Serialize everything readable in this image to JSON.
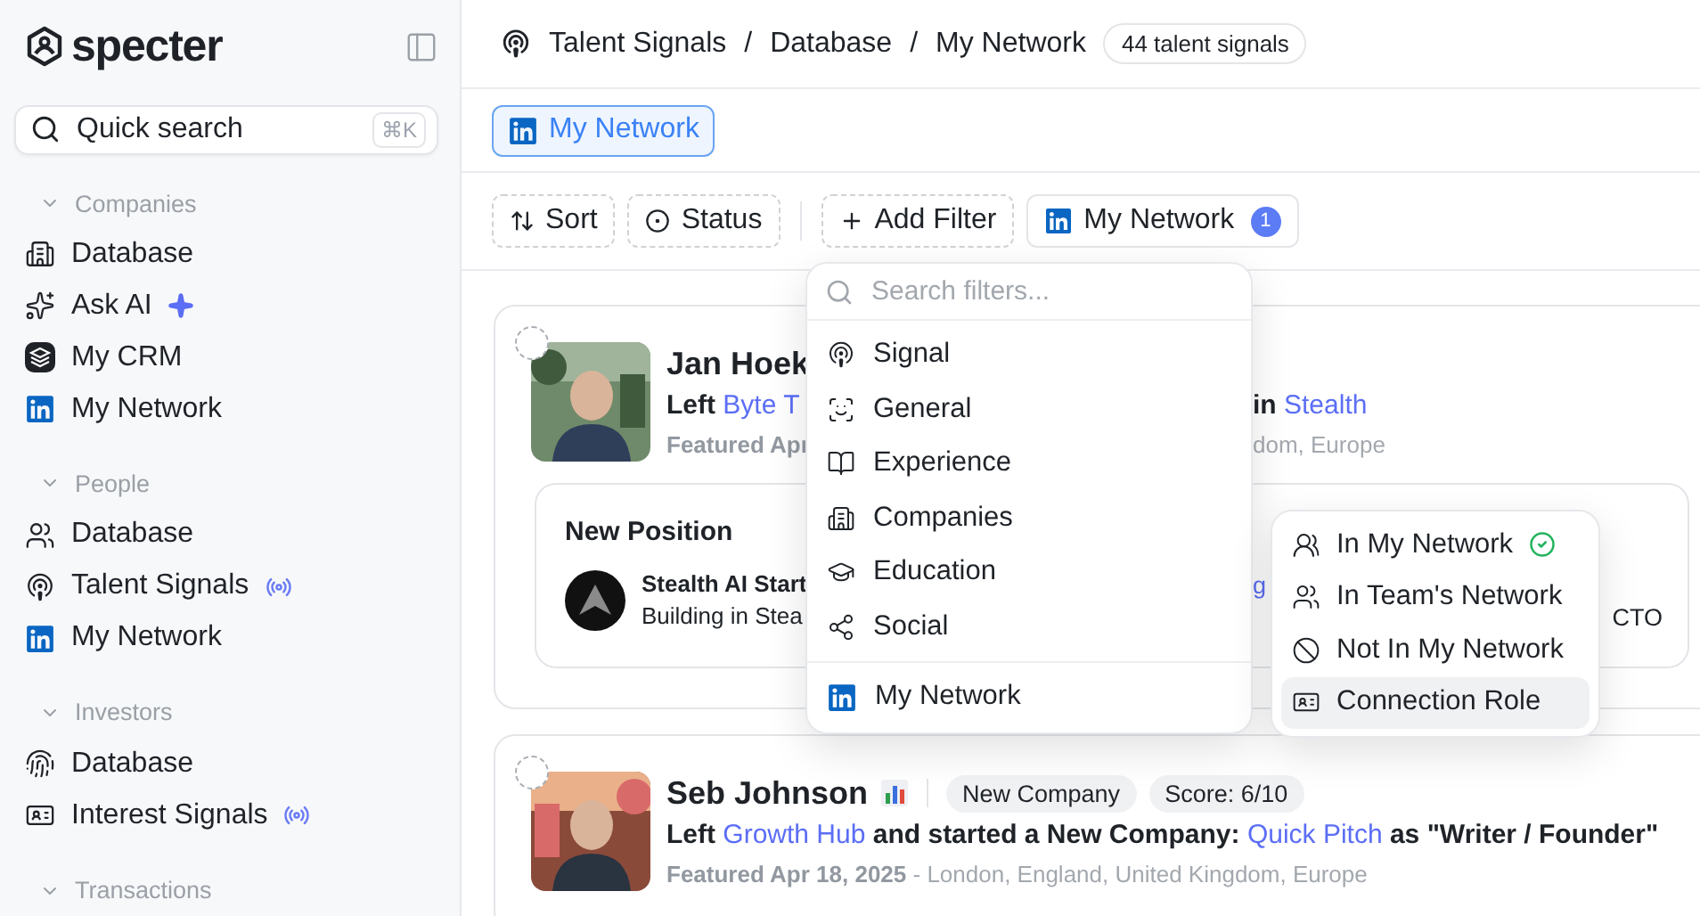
{
  "sidebar": {
    "brand": "specter",
    "quick_search": {
      "label": "Quick search",
      "shortcut": "⌘K"
    },
    "sections": [
      {
        "title": "Companies",
        "expanded": true,
        "items": [
          {
            "label": "Database",
            "kind": "plain"
          },
          {
            "label": "Ask AI",
            "kind": "ai"
          },
          {
            "label": "My CRM",
            "kind": "plain"
          },
          {
            "label": "My Network",
            "kind": "plain"
          }
        ]
      },
      {
        "title": "People",
        "expanded": true,
        "items": [
          {
            "label": "Database",
            "kind": "plain"
          },
          {
            "label": "Talent Signals",
            "kind": "live"
          },
          {
            "label": "My Network",
            "kind": "plain"
          }
        ]
      },
      {
        "title": "Investors",
        "expanded": true,
        "items": [
          {
            "label": "Database",
            "kind": "plain"
          },
          {
            "label": "Interest Signals",
            "kind": "live"
          }
        ]
      },
      {
        "title": "Transactions",
        "expanded": true
      }
    ]
  },
  "header": {
    "breadcrumb": [
      {
        "label": "Talent Signals"
      },
      {
        "separator": "/",
        "label": "Database"
      },
      {
        "separator": "/",
        "label": "My Network"
      }
    ],
    "count": "44 talent signals"
  },
  "tabs": [
    {
      "label": "My Network",
      "selected": true
    }
  ],
  "toolbar": [
    {
      "kind": "sort",
      "label": "Sort"
    },
    {
      "kind": "status",
      "label": "Status"
    },
    {
      "kind": "add",
      "label": "Add Filter"
    },
    {
      "kind": "network",
      "label": "My Network",
      "count": "1"
    }
  ],
  "filter_menu": {
    "placeholder": "Search filters...",
    "groups": [
      {
        "items": [
          {
            "label": "Signal"
          },
          {
            "label": "General"
          },
          {
            "label": "Experience"
          },
          {
            "label": "Companies"
          },
          {
            "label": "Education"
          },
          {
            "label": "Social"
          }
        ]
      },
      {
        "items": [
          {
            "label": "My Network"
          }
        ]
      }
    ]
  },
  "submenu": {
    "items": [
      {
        "label": "In My Network",
        "checked": true,
        "selected": false
      },
      {
        "label": "In Team's Network",
        "checked": false,
        "selected": false
      },
      {
        "label": "Not In My Network",
        "checked": false,
        "selected": false
      },
      {
        "label": "Connection Role",
        "checked": false,
        "selected": true
      }
    ]
  },
  "cards": [
    {
      "selected": false,
      "name": "Jan Hoek",
      "chart_badge": false,
      "headline": [
        {
          "text": "Left "
        },
        {
          "text": "Byte T",
          "link": true
        }
      ],
      "headline_right": [
        {
          "text": "in "
        },
        {
          "text": "Stealth",
          "link": true
        }
      ],
      "meta": [
        {
          "text": "Featured Apr",
          "strong": true
        }
      ],
      "meta_right": [
        {
          "text": "dom, Europe"
        }
      ],
      "position": {
        "title": "New Position",
        "company": "Stealth AI Start",
        "description": "Building in Stea",
        "link_fragment": "g",
        "role_fragment": "CTO"
      }
    },
    {
      "selected": false,
      "name": "Seb Johnson",
      "chart_badge": true,
      "tags": [
        "New Company",
        "Score: 6/10"
      ],
      "headline": [
        {
          "text": "Left "
        },
        {
          "text": "Growth Hub",
          "link": true
        },
        {
          "text": " and started a New Company: "
        },
        {
          "text": "Quick Pitch",
          "link": true
        },
        {
          "text": " as \"Writer / Founder\""
        }
      ],
      "meta": [
        {
          "text": "Featured Apr 18, 2025",
          "strong": true
        },
        {
          "text": " - London, England, United Kingdom, Europe"
        }
      ]
    }
  ]
}
